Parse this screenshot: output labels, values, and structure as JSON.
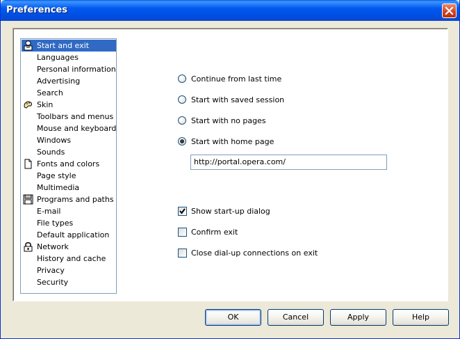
{
  "window": {
    "title": "Preferences"
  },
  "sidebar": {
    "items": [
      {
        "label": "Start and exit",
        "icon": "person-icon",
        "selected": true
      },
      {
        "label": "Languages"
      },
      {
        "label": "Personal information"
      },
      {
        "label": "Advertising"
      },
      {
        "label": "Search"
      },
      {
        "label": "Skin",
        "icon": "skin-icon"
      },
      {
        "label": "Toolbars and menus"
      },
      {
        "label": "Mouse and keyboard"
      },
      {
        "label": "Windows"
      },
      {
        "label": "Sounds"
      },
      {
        "label": "Fonts and colors",
        "icon": "document-icon"
      },
      {
        "label": "Page style"
      },
      {
        "label": "Multimedia"
      },
      {
        "label": "Programs and paths",
        "icon": "floppy-icon"
      },
      {
        "label": "E-mail"
      },
      {
        "label": "File types"
      },
      {
        "label": "Default application"
      },
      {
        "label": "Network",
        "icon": "lock-icon"
      },
      {
        "label": "History and cache"
      },
      {
        "label": "Privacy"
      },
      {
        "label": "Security"
      }
    ]
  },
  "startup": {
    "options": [
      {
        "label": "Continue from last time",
        "selected": false
      },
      {
        "label": "Start with saved session",
        "selected": false
      },
      {
        "label": "Start with no pages",
        "selected": false
      },
      {
        "label": "Start with home page",
        "selected": true
      }
    ],
    "home_page_url": "http://portal.opera.com/"
  },
  "checks": [
    {
      "label": "Show start-up dialog",
      "checked": true
    },
    {
      "label": "Confirm exit",
      "checked": false
    },
    {
      "label": "Close dial-up connections on exit",
      "checked": false
    }
  ],
  "buttons": {
    "ok": "OK",
    "cancel": "Cancel",
    "apply": "Apply",
    "help": "Help"
  }
}
